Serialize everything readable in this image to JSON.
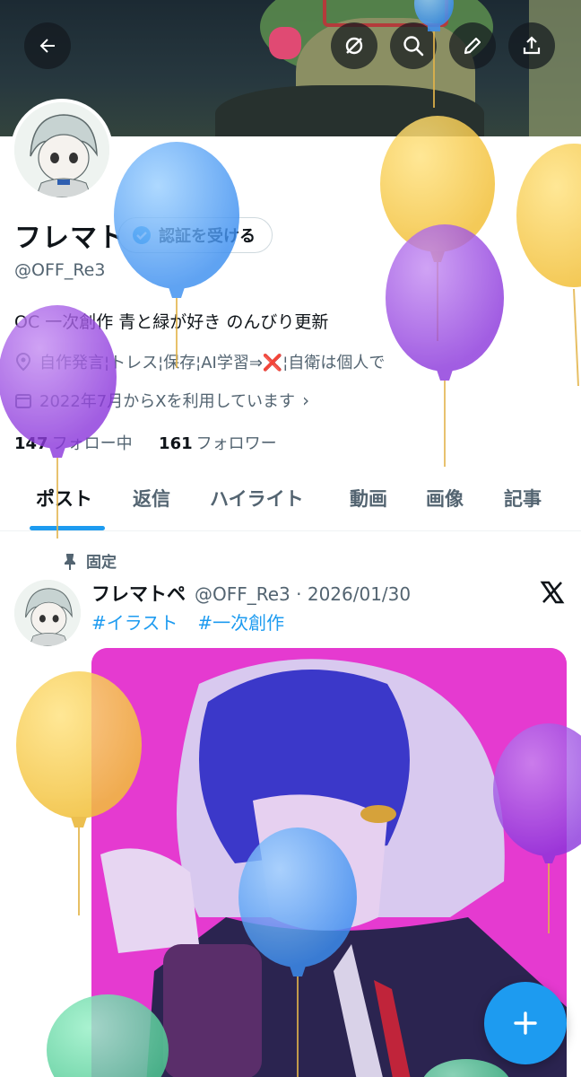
{
  "profile": {
    "name": "フレマトペ",
    "verify_label": "認証を受ける",
    "handle": "@OFF_Re3",
    "bio": "OC 一次創作 青と緑が好き のんびり更新",
    "location": "自作発言¦トレス¦保存¦AI学習⇒❌¦自衛は個人で",
    "joined": "2022年7月からXを利用しています",
    "following_count": "147",
    "following_label": "フォロー中",
    "followers_count": "161",
    "followers_label": "フォロワー"
  },
  "tabs": [
    "ポスト",
    "返信",
    "ハイライト",
    "動画",
    "画像",
    "記事"
  ],
  "pinned_post": {
    "pinned_label": "固定",
    "author_name": "フレマトペ",
    "meta": "@OFF_Re3 · 2026/01/30",
    "hashtags": [
      "#イラスト",
      "#一次創作"
    ]
  },
  "colors": {
    "accent": "#1d9bf0",
    "balloon_blue": "#5aaaf5",
    "balloon_yellow": "#f5c94a",
    "balloon_purple": "#9b4ee0",
    "balloon_green": "#6cd6a8",
    "art_background": "#e53ad0"
  },
  "icons": [
    "back-arrow-icon",
    "grok-icon",
    "search-icon",
    "edit-pencil-icon",
    "share-icon",
    "verified-badge-icon",
    "location-icon",
    "calendar-icon",
    "pin-icon",
    "x-logo-icon",
    "plus-icon"
  ]
}
